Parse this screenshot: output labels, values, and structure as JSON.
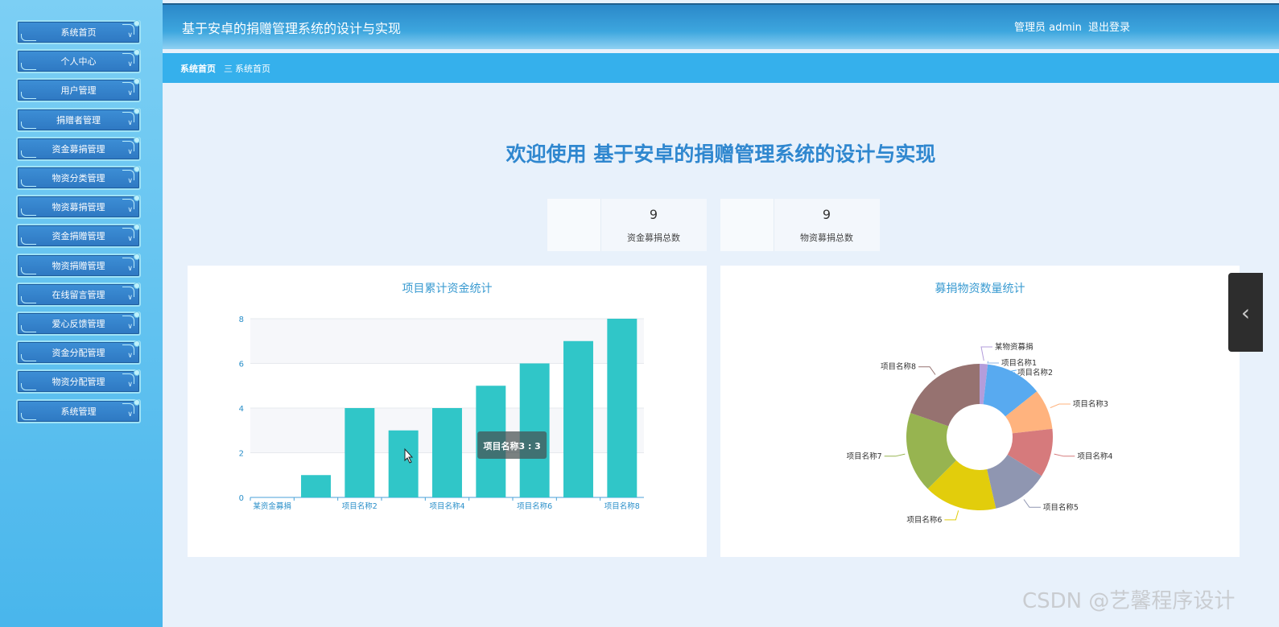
{
  "sidebar": {
    "items": [
      {
        "label": "系统首页"
      },
      {
        "label": "个人中心"
      },
      {
        "label": "用户管理"
      },
      {
        "label": "捐赠者管理"
      },
      {
        "label": "资金募捐管理"
      },
      {
        "label": "物资分类管理"
      },
      {
        "label": "物资募捐管理"
      },
      {
        "label": "资金捐赠管理"
      },
      {
        "label": "物资捐赠管理"
      },
      {
        "label": "在线留言管理"
      },
      {
        "label": "爱心反馈管理"
      },
      {
        "label": "资金分配管理"
      },
      {
        "label": "物资分配管理"
      },
      {
        "label": "系统管理"
      }
    ]
  },
  "header": {
    "title": "基于安卓的捐赠管理系统的设计与实现",
    "user": "管理员 admin",
    "logout": "退出登录"
  },
  "breadcrumb": {
    "home": "系统首页",
    "separator": "三",
    "current": "系统首页"
  },
  "welcome": "欢迎使用 基于安卓的捐赠管理系统的设计与实现",
  "stats": [
    {
      "value": "9",
      "label": "资金募捐总数"
    },
    {
      "value": "9",
      "label": "物资募捐总数"
    }
  ],
  "tooltip": "项目名称3 : 3",
  "watermark": "CSDN @艺馨程序设计",
  "side_toggle_icon": "chevron-left-icon",
  "colors": {
    "accent": "#2f87cf",
    "bar": "#30c6c8",
    "subbar": "#35b0ec"
  },
  "chart_data": [
    {
      "type": "bar",
      "title": "项目累计资金统计",
      "categories": [
        "某资金募捐",
        "项目名称1",
        "项目名称2",
        "项目名称3",
        "项目名称4",
        "项目名称5",
        "项目名称6",
        "项目名称7",
        "项目名称8"
      ],
      "visible_tick_labels": [
        "某资金募捐",
        "项目名称2",
        "项目名称4",
        "项目名称6",
        "项目名称8"
      ],
      "values": [
        0,
        1,
        4,
        3,
        4,
        5,
        6,
        7,
        8
      ],
      "ylim": [
        0,
        8
      ],
      "yticks": [
        0,
        2,
        4,
        6,
        8
      ],
      "grid": true
    },
    {
      "type": "pie",
      "title": "募捐物资数量统计",
      "donut": true,
      "labels": [
        "某物资募捐",
        "项目名称1",
        "项目名称2",
        "项目名称3",
        "项目名称4",
        "项目名称5",
        "项目名称6",
        "项目名称7",
        "项目名称8"
      ],
      "values": [
        1,
        0,
        7,
        5,
        6,
        7,
        9,
        10,
        11
      ],
      "colors": [
        "#b39ddb",
        "#8fb5e6",
        "#58aaf0",
        "#ffb37e",
        "#d67a7c",
        "#8f96b1",
        "#e2cd0c",
        "#97b450",
        "#967270"
      ]
    }
  ]
}
